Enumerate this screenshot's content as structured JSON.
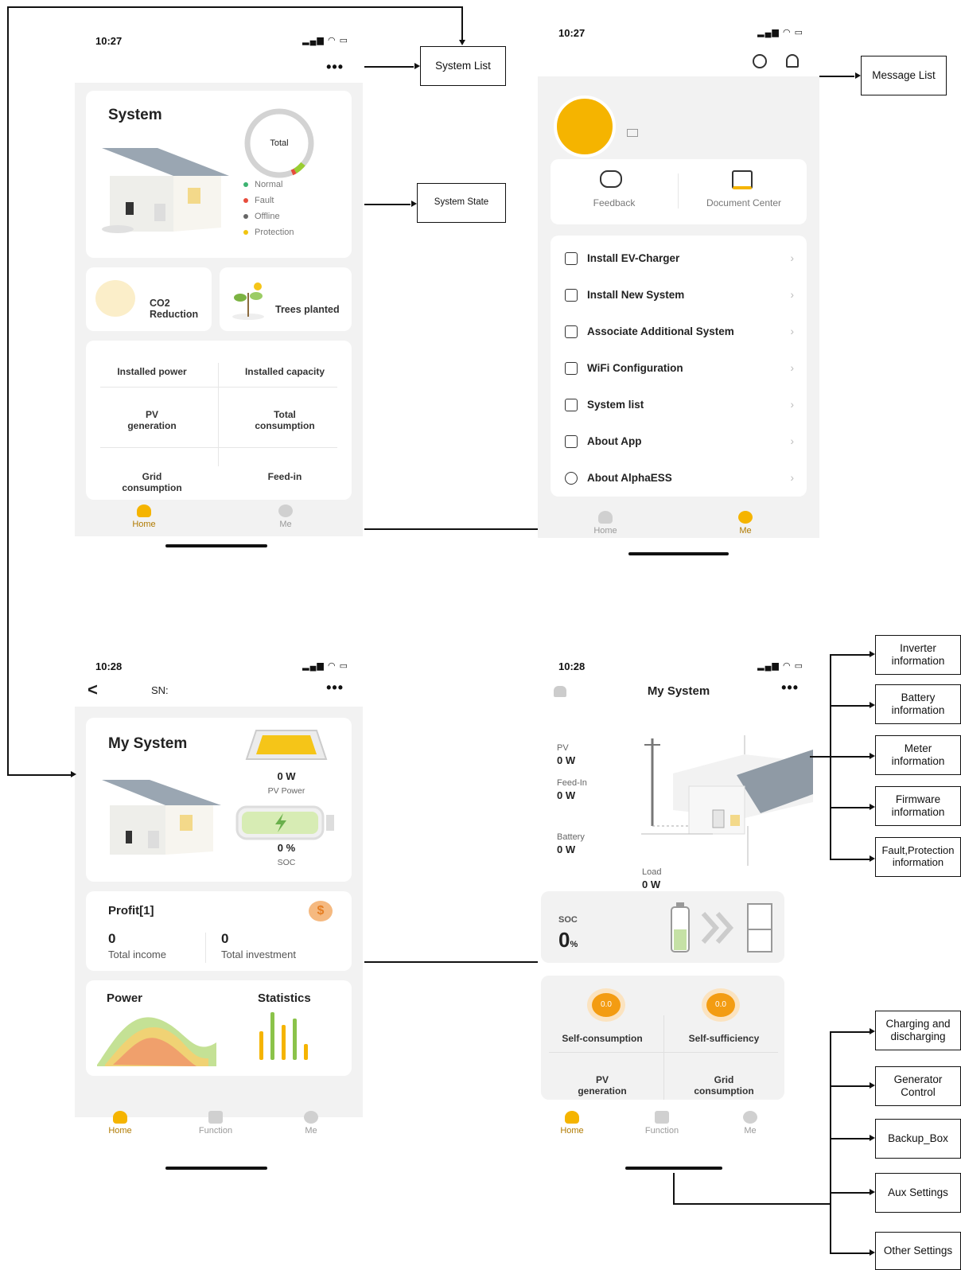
{
  "screen1": {
    "time": "10:27",
    "menu_dots": "•••",
    "system_title": "System",
    "donut_label": "Total",
    "legend": [
      {
        "label": "Normal",
        "color": "#3cb371"
      },
      {
        "label": "Fault",
        "color": "#e74c3c"
      },
      {
        "label": "Offline",
        "color": "#666666"
      },
      {
        "label": "Protection",
        "color": "#f1c40f"
      }
    ],
    "co2": "CO2\nReduction",
    "trees": "Trees planted",
    "stats": [
      "Installed power",
      "Installed capacity",
      "PV\ngeneration",
      "Total\nconsumption",
      "Grid\nconsumption",
      "Feed-in"
    ],
    "tabs": [
      "Home",
      "Me"
    ]
  },
  "screen2": {
    "time": "10:27",
    "feedback": "Feedback",
    "document_center": "Document Center",
    "menu": [
      "Install EV-Charger",
      "Install New System",
      "Associate Additional System",
      "WiFi Configuration",
      "System list",
      "About App",
      "About AlphaESS"
    ],
    "tabs": [
      "Home",
      "Me"
    ]
  },
  "screen3": {
    "time": "10:28",
    "back": "<",
    "sn": "SN:",
    "menu_dots": "•••",
    "title": "My System",
    "pv_value": "0 W",
    "pv_label": "PV Power",
    "soc_value": "0 %",
    "soc_label": "SOC",
    "profit_title": "Profit[1]",
    "income_value": "0",
    "income_label": "Total income",
    "investment_value": "0",
    "investment_label": "Total investment",
    "power": "Power",
    "statistics": "Statistics",
    "tabs": [
      "Home",
      "Function",
      "Me"
    ]
  },
  "screen4": {
    "time": "10:28",
    "title": "My System",
    "menu_dots": "•••",
    "pv_label": "PV",
    "pv_value": "0 W",
    "feedin_label": "Feed-In",
    "feedin_value": "0 W",
    "battery_label": "Battery",
    "battery_value": "0 W",
    "load_label": "Load",
    "load_value": "0 W",
    "soc_label": "SOC",
    "soc_value": "0",
    "soc_unit": "%",
    "gauge_value": "0.0",
    "self_consumption": "Self-consumption",
    "self_sufficiency": "Self-sufficiency",
    "pv_generation": "PV\ngeneration",
    "grid_consumption": "Grid\nconsumption",
    "tabs": [
      "Home",
      "Function",
      "Me"
    ]
  },
  "annotations": {
    "system_list": "System List",
    "system_state": "System State",
    "message_list": "Message List",
    "right_top": [
      "Inverter\ninformation",
      "Battery\ninformation",
      "Meter\ninformation",
      "Firmware\ninformation",
      "Fault,Protection\ninformation"
    ],
    "right_bottom": [
      "Charging and\ndischarging",
      "Generator\nControl",
      "Backup_Box",
      "Aux Settings",
      "Other Settings"
    ]
  }
}
